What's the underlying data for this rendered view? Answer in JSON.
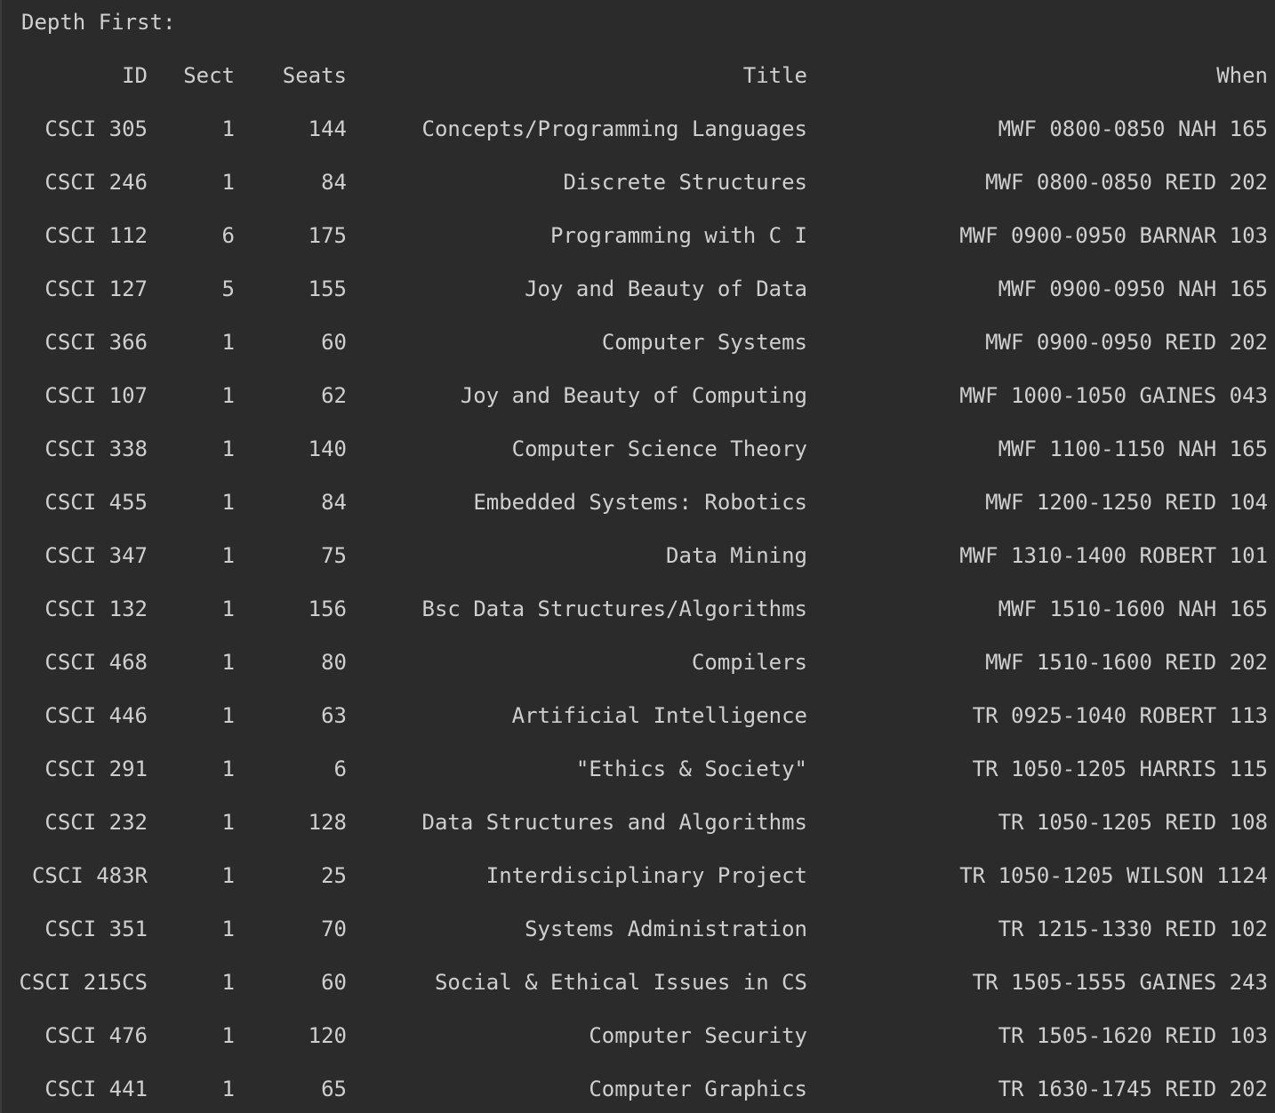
{
  "heading": "Depth First:",
  "columns": [
    "ID",
    "Sect",
    "Seats",
    "Title",
    "When"
  ],
  "rows": [
    [
      "CSCI 305",
      "1",
      "144",
      "Concepts/Programming Languages",
      "MWF 0800-0850 NAH 165"
    ],
    [
      "CSCI 246",
      "1",
      "84",
      "Discrete Structures",
      "MWF 0800-0850 REID 202"
    ],
    [
      "CSCI 112",
      "6",
      "175",
      "Programming with C I",
      "MWF 0900-0950 BARNAR 103"
    ],
    [
      "CSCI 127",
      "5",
      "155",
      "Joy and Beauty of Data",
      "MWF 0900-0950 NAH 165"
    ],
    [
      "CSCI 366",
      "1",
      "60",
      "Computer Systems",
      "MWF 0900-0950 REID 202"
    ],
    [
      "CSCI 107",
      "1",
      "62",
      "Joy and Beauty of Computing",
      "MWF 1000-1050 GAINES 043"
    ],
    [
      "CSCI 338",
      "1",
      "140",
      "Computer Science Theory",
      "MWF 1100-1150 NAH 165"
    ],
    [
      "CSCI 455",
      "1",
      "84",
      "Embedded Systems: Robotics",
      "MWF 1200-1250 REID 104"
    ],
    [
      "CSCI 347",
      "1",
      "75",
      "Data Mining",
      "MWF 1310-1400 ROBERT 101"
    ],
    [
      "CSCI 132",
      "1",
      "156",
      "Bsc Data Structures/Algorithms",
      "MWF 1510-1600 NAH 165"
    ],
    [
      "CSCI 468",
      "1",
      "80",
      "Compilers",
      "MWF 1510-1600 REID 202"
    ],
    [
      "CSCI 446",
      "1",
      "63",
      "Artificial Intelligence",
      "TR 0925-1040 ROBERT 113"
    ],
    [
      "CSCI 291",
      "1",
      "6",
      "\"Ethics & Society\"",
      "TR 1050-1205 HARRIS 115"
    ],
    [
      "CSCI 232",
      "1",
      "128",
      "Data Structures and Algorithms",
      "TR 1050-1205 REID 108"
    ],
    [
      "CSCI 483R",
      "1",
      "25",
      "Interdisciplinary Project",
      "TR 1050-1205 WILSON 1124"
    ],
    [
      "CSCI 351",
      "1",
      "70",
      "Systems Administration",
      "TR 1215-1330 REID 102"
    ],
    [
      "CSCI 215CS",
      "1",
      "60",
      "Social & Ethical Issues in CS",
      "TR 1505-1555 GAINES 243"
    ],
    [
      "CSCI 476",
      "1",
      "120",
      "Computer Security",
      "TR 1505-1620 REID 103"
    ],
    [
      "CSCI 441",
      "1",
      "65",
      "Computer Graphics",
      "TR 1630-1745 REID 202"
    ]
  ],
  "colors": {
    "background": "#2b2b2b",
    "text": "#cfcfcf"
  }
}
